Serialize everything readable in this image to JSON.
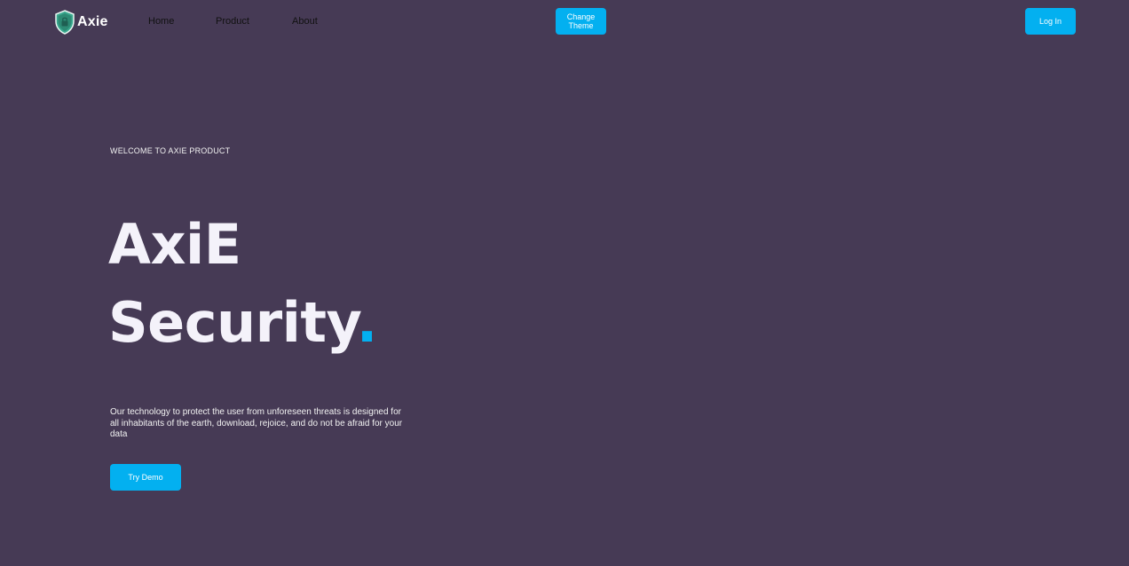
{
  "brand": {
    "name": "Axie",
    "logo_icon": "shield-lock-icon",
    "colors": {
      "shield_outer": "#3aa98f",
      "shield_inner": "#2d8a74"
    }
  },
  "nav": {
    "links": [
      {
        "label": "Home"
      },
      {
        "label": "Product"
      },
      {
        "label": "About"
      }
    ],
    "change_theme_label": "Change\nTheme",
    "login_label": "Log In"
  },
  "hero": {
    "eyebrow": "WELCOME TO AXIE PRODUCT",
    "title_line1": "AxiE",
    "title_line2": "Security",
    "title_dot": ".",
    "description": "Our technology to protect the user from unforeseen threats is designed for all inhabitants of the earth, download, rejoice, and do not be afraid for your data",
    "cta_label": "Try Demo"
  },
  "theme": {
    "background": "#463a55",
    "accent": "#03b0f0",
    "nav_text": "#111111",
    "heading_text": "#f4f2fa"
  }
}
